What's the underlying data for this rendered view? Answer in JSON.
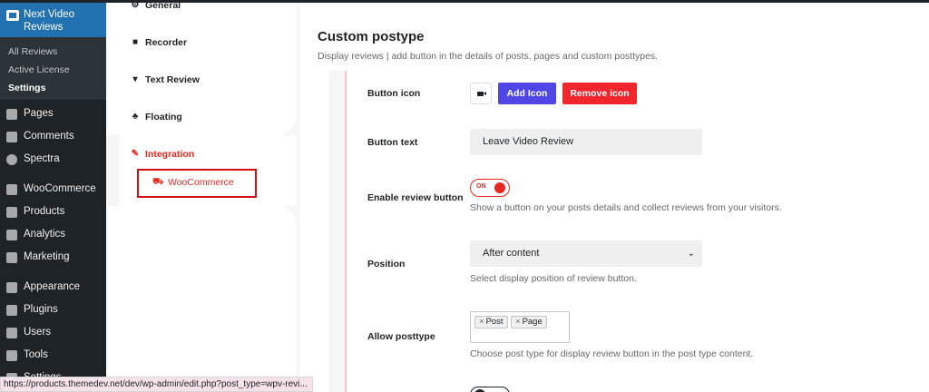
{
  "wp_sidebar": {
    "plugin_title": "Next Video Reviews",
    "submenu": [
      {
        "label": "All Reviews"
      },
      {
        "label": "Active License"
      },
      {
        "label": "Settings"
      }
    ],
    "menu": [
      {
        "label": "Pages",
        "icon": "pages-icon"
      },
      {
        "label": "Comments",
        "icon": "comments-icon"
      },
      {
        "label": "Spectra",
        "icon": "spectra-icon"
      },
      {
        "label": "WooCommerce",
        "icon": "woocommerce-icon"
      },
      {
        "label": "Products",
        "icon": "products-icon"
      },
      {
        "label": "Analytics",
        "icon": "analytics-icon"
      },
      {
        "label": "Marketing",
        "icon": "marketing-icon"
      },
      {
        "label": "Appearance",
        "icon": "appearance-icon"
      },
      {
        "label": "Plugins",
        "icon": "plugins-icon"
      },
      {
        "label": "Users",
        "icon": "users-icon"
      },
      {
        "label": "Tools",
        "icon": "tools-icon"
      },
      {
        "label": "Settings",
        "icon": "settings-icon"
      }
    ]
  },
  "plugin_nav": {
    "items": [
      {
        "label": "General",
        "icon": "gear-icon"
      },
      {
        "label": "Recorder",
        "icon": "video-camera-icon"
      },
      {
        "label": "Text Review",
        "icon": "speech-bubble-icon"
      },
      {
        "label": "Floating",
        "icon": "cluster-icon"
      },
      {
        "label": "Integration",
        "icon": "plug-icon"
      }
    ],
    "sub_item": {
      "label": "WooCommerce",
      "icon": "cart-icon"
    }
  },
  "main": {
    "title": "Custom postype",
    "subtitle": "Display reviews | add button in the details of posts, pages and custom posttypes.",
    "button_icon": {
      "label": "Button icon",
      "add_label": "Add Icon",
      "remove_label": "Remove icon"
    },
    "button_text": {
      "label": "Button text",
      "value": "Leave Video Review"
    },
    "enable_review": {
      "label": "Enable review button",
      "toggle_text": "ON",
      "help": "Show a button on your posts details and collect reviews from your visitors."
    },
    "position": {
      "label": "Position",
      "value": "After content",
      "help": "Select display position of review button."
    },
    "allow_posttype": {
      "label": "Allow posttype",
      "tags": [
        "Post",
        "Page"
      ],
      "help": "Choose post type for display review button in the post type content."
    }
  },
  "status_bar": {
    "url": "https://products.themedev.net/dev/wp-admin/edit.php?post_type=wpv-revi..."
  },
  "colors": {
    "accent_red": "#e8281f",
    "add_button": "#4f46e5",
    "remove_button": "#f1262d",
    "wp_blue": "#2271b1",
    "wp_dark": "#1d2327"
  }
}
